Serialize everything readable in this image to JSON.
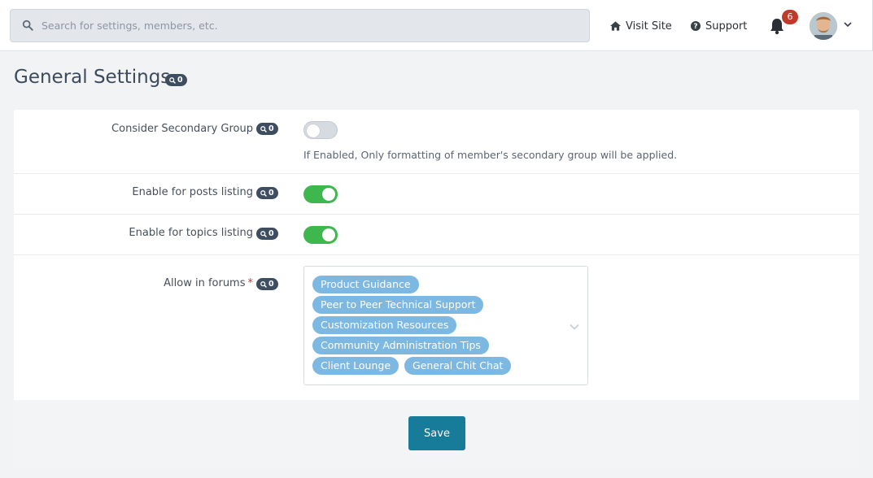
{
  "search": {
    "placeholder": "Search for settings, members, etc.",
    "value": ""
  },
  "header": {
    "visit_site": "Visit Site",
    "support": "Support",
    "notification_count": "6"
  },
  "page": {
    "title": "General Settings",
    "title_badge_count": "0"
  },
  "settings": {
    "secondary_group": {
      "label": "Consider Secondary Group",
      "badge": "0",
      "enabled": false,
      "help": "If Enabled, Only formatting of member's secondary group will be applied."
    },
    "posts_listing": {
      "label": "Enable for posts listing",
      "badge": "0",
      "enabled": true
    },
    "topics_listing": {
      "label": "Enable for topics listing",
      "badge": "0",
      "enabled": true
    },
    "forums": {
      "label": "Allow in forums",
      "required_mark": "*",
      "badge": "0",
      "tags": [
        "Product Guidance",
        "Peer to Peer Technical Support",
        "Customization Resources",
        "Community Administration Tips",
        "Client Lounge",
        "General Chit Chat"
      ]
    }
  },
  "footer": {
    "save_label": "Save"
  },
  "colors": {
    "toggle_on": "#3fb74f",
    "tag": "#7cb8e2",
    "save": "#177b9a",
    "badge": "#3e4d5f",
    "notification": "#c0392b"
  }
}
